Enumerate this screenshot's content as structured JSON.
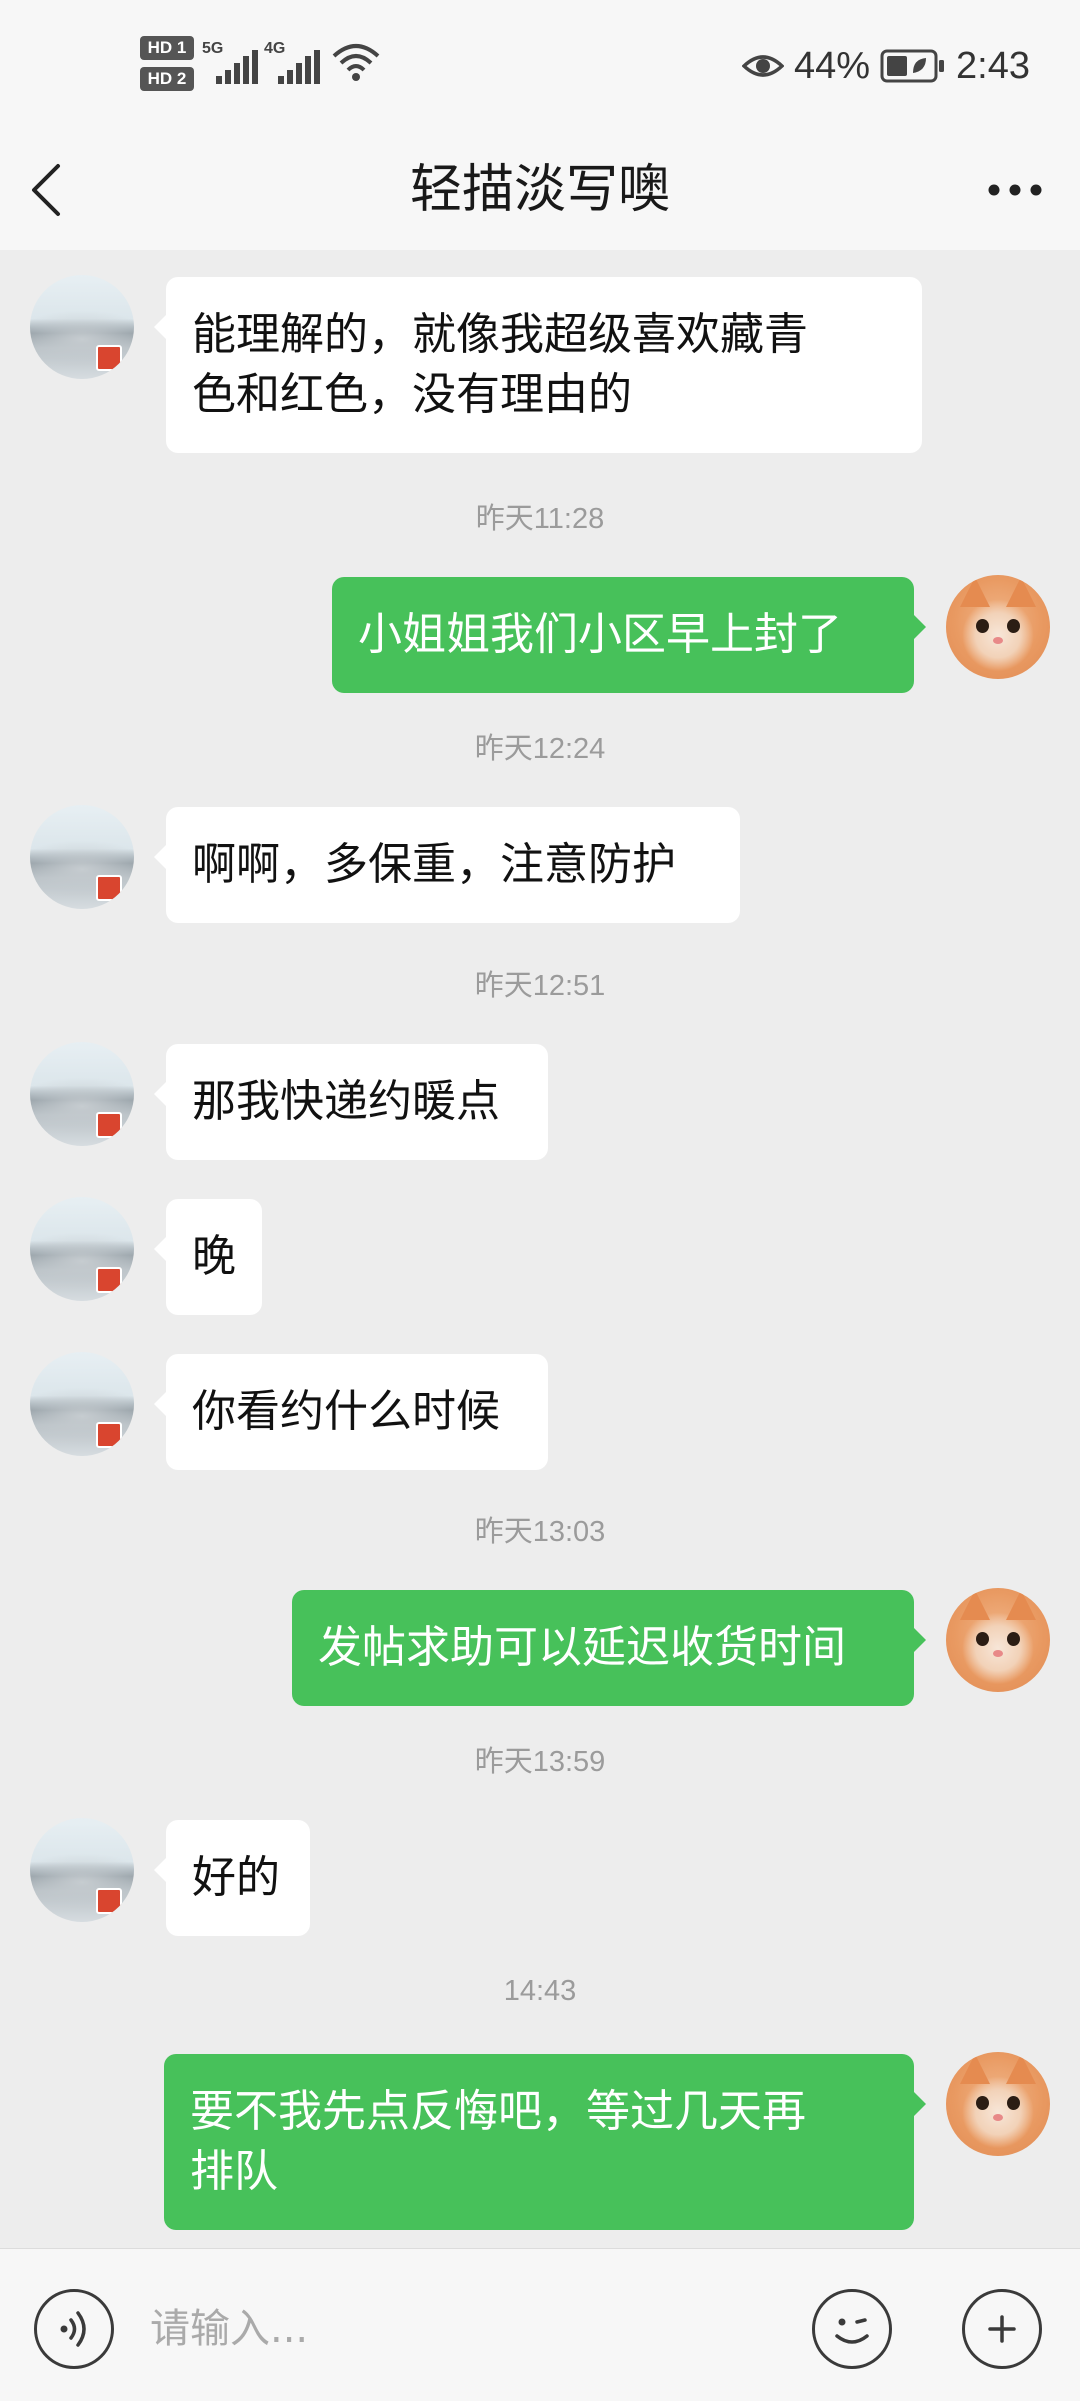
{
  "status_bar": {
    "sim1_label": "HD 1",
    "sim2_label": "HD 2",
    "network1": "5G",
    "network2": "4G",
    "battery": "44%",
    "time": "2:43",
    "icons": [
      "hd-icon",
      "signal-icon",
      "wifi-icon",
      "eye-icon",
      "battery-icon"
    ]
  },
  "header": {
    "title": "轻描淡写噢",
    "back_icon": "chevron-left-icon",
    "more_icon": "more-dots-icon"
  },
  "messages": [
    {
      "type": "in",
      "lines": [
        "能理解的，就像我超级喜欢藏青",
        "色和红色，没有理由的"
      ]
    },
    {
      "type": "time",
      "text": "昨天11:28"
    },
    {
      "type": "out",
      "lines": [
        "小姐姐我们小区早上封了"
      ]
    },
    {
      "type": "time",
      "text": "昨天12:24"
    },
    {
      "type": "in",
      "lines": [
        "啊啊，多保重，注意防护"
      ]
    },
    {
      "type": "time",
      "text": "昨天12:51"
    },
    {
      "type": "in",
      "lines": [
        "那我快递约暖点"
      ]
    },
    {
      "type": "in",
      "lines": [
        "晚"
      ]
    },
    {
      "type": "in",
      "lines": [
        "你看约什么时候"
      ]
    },
    {
      "type": "time",
      "text": "昨天13:03"
    },
    {
      "type": "out",
      "lines": [
        "发帖求助可以延迟收货时间"
      ]
    },
    {
      "type": "time",
      "text": "昨天13:59"
    },
    {
      "type": "in",
      "lines": [
        "好的"
      ]
    },
    {
      "type": "time",
      "text": "14:43"
    },
    {
      "type": "out",
      "lines": [
        "要不我先点反悔吧，等过几天再",
        "排队"
      ]
    }
  ],
  "input_bar": {
    "placeholder": "请输入...",
    "value": "",
    "voice_icon": "voice-icon",
    "emoji_icon": "emoji-icon",
    "plus_icon": "plus-icon"
  },
  "colors": {
    "chat_background": "#ededed",
    "outgoing_bubble": "#47c15a",
    "incoming_bubble": "#ffffff",
    "timestamp_text": "#9b9b9b"
  }
}
